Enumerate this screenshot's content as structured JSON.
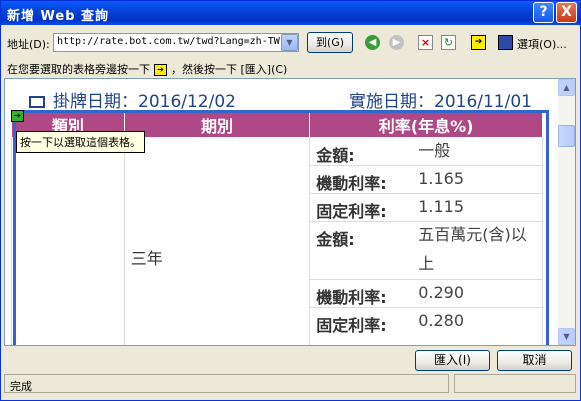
{
  "window": {
    "title": "新增 Web 查詢",
    "help_label": "?",
    "close_label": "X"
  },
  "address": {
    "label": "地址(D):",
    "url": "http://rate.bot.com.tw/twd?Lang=zh-TW",
    "go_label": "到(G)",
    "options_label": "選項(O)..."
  },
  "instruction": {
    "before": "在您要選取的表格旁邊按一下",
    "after": "，然後按一下 [匯入](C)"
  },
  "page": {
    "posting_date": "掛牌日期：2016/12/02",
    "effective_date": "實施日期：2016/11/01",
    "headers": [
      "類別",
      "期別",
      "利率(年息%)"
    ],
    "period": "三年",
    "rows": [
      {
        "key": "金額:",
        "value": "一般"
      },
      {
        "key": "機動利率:",
        "value": "1.165"
      },
      {
        "key": "固定利率:",
        "value": "1.115"
      },
      {
        "key": "金額:",
        "value": "五百萬元(含)以上"
      },
      {
        "key": "機動利率:",
        "value": "0.290"
      },
      {
        "key": "固定利率:",
        "value": "0.280"
      }
    ]
  },
  "tooltip": "按一下以選取這個表格。",
  "buttons": {
    "import": "匯入(I)",
    "cancel": "取消"
  },
  "status": {
    "text": "完成"
  }
}
